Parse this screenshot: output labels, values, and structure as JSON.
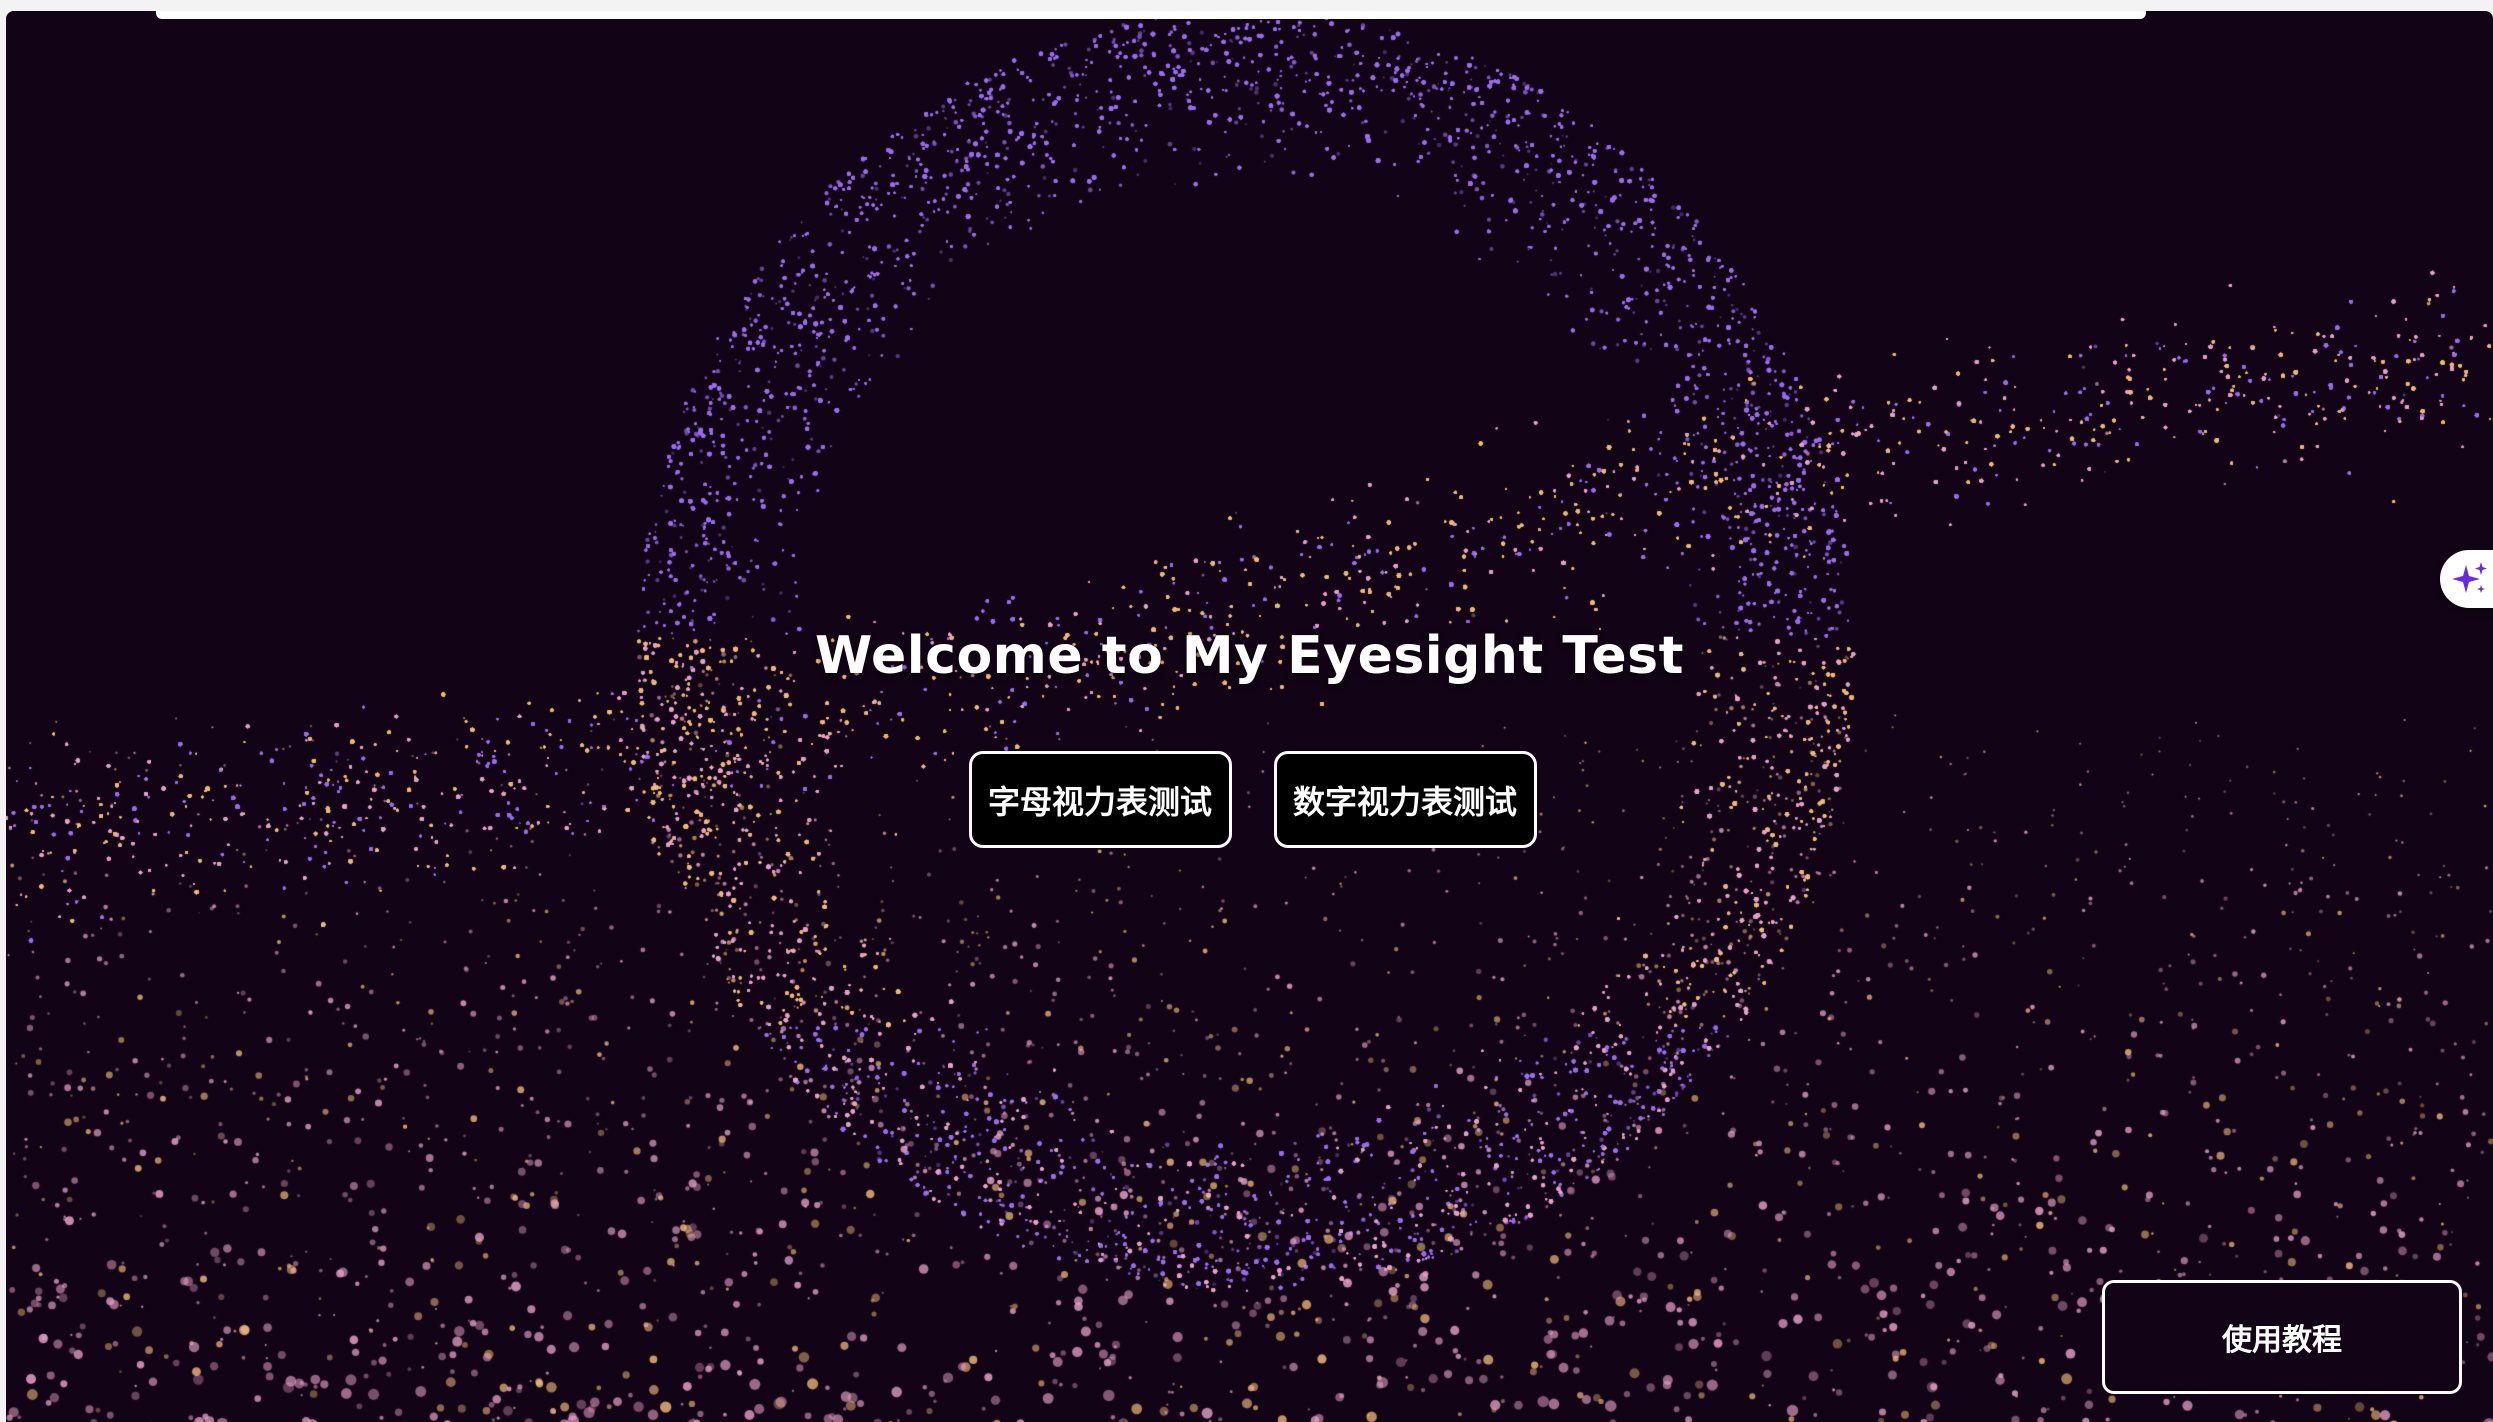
{
  "page": {
    "title": "Welcome to My Eyesight Test"
  },
  "buttons": {
    "letter_test": "字母视力表测试",
    "number_test": "数字视力表测试",
    "tutorial": "使用教程"
  },
  "side_widget": {
    "icon": "sparkle-icon"
  },
  "colors": {
    "background": "#120416",
    "particle_purple": "#9a6cf0",
    "particle_pink": "#e7a0c8",
    "particle_gold": "#f0b878",
    "button_bg": "#000000",
    "button_border": "#ffffff",
    "sparkle_accent": "#6a2be0"
  }
}
